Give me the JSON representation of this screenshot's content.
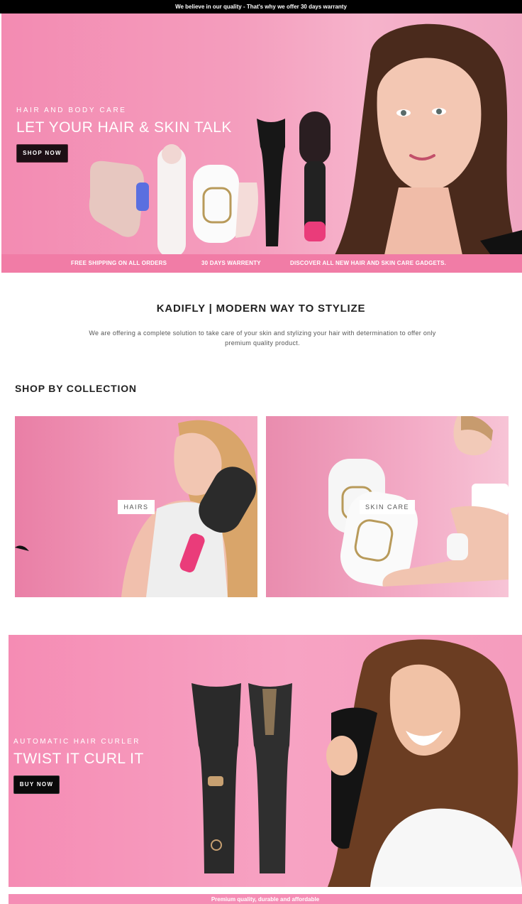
{
  "announcement": {
    "text": "We believe in our quality - That's why we offer 30 days warranty"
  },
  "hero": {
    "kicker": "HAIR AND BODY CARE",
    "headline": "LET YOUR HAIR & SKIN TALK",
    "cta_label": "SHOP NOW",
    "features": [
      "FREE SHIPPING ON ALL ORDERS",
      "30 DAYS WARRENTY",
      "DISCOVER ALL NEW HAIR AND SKIN CARE GADGETS."
    ]
  },
  "intro": {
    "title": "KADIFLY | MODERN WAY TO STYLIZE",
    "text": "We are offering a complete solution to take care of your skin and stylizing your hair with determination to offer only premium quality product."
  },
  "collections": {
    "title": "SHOP BY COLLECTION",
    "items": [
      {
        "label": "HAIRS"
      },
      {
        "label": "SKIN CARE"
      }
    ]
  },
  "promo": {
    "kicker": "AUTOMATIC HAIR CURLER",
    "headline": "TWIST IT CURL IT",
    "cta_label": "BUY NOW",
    "tagline": "Premium quality, durable and affordable"
  },
  "colors": {
    "pink": "#f38bb2",
    "accent": "#f17ca6",
    "dark": "#1c0f14"
  }
}
